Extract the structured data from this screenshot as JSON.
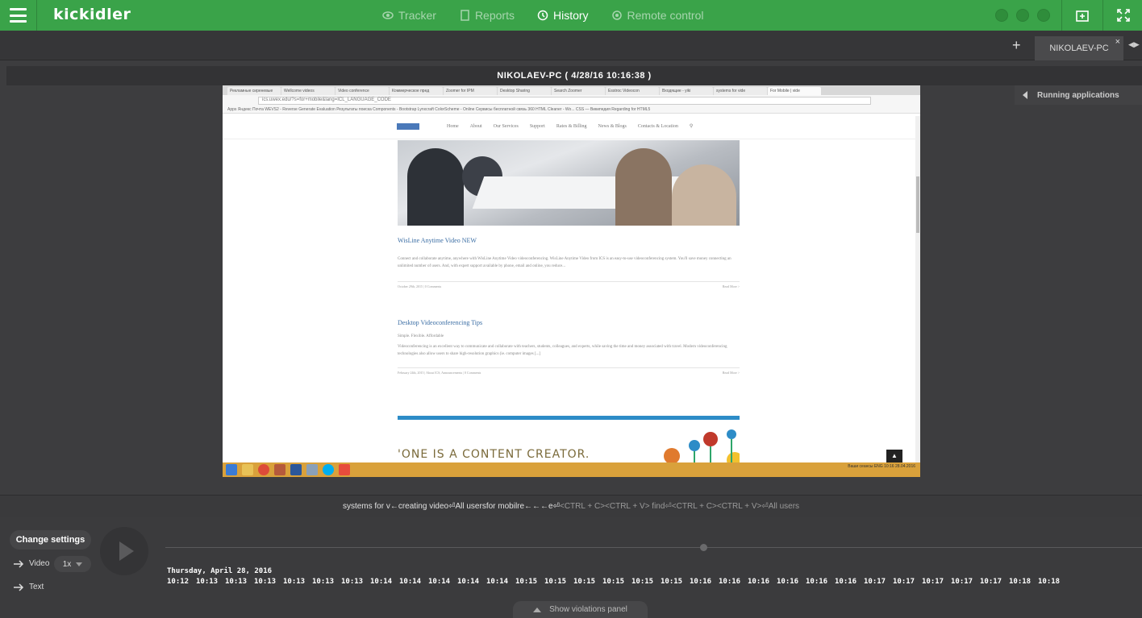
{
  "app": {
    "logo": "kickidler",
    "nav": [
      {
        "label": "Tracker",
        "icon": "eye-icon",
        "active": false
      },
      {
        "label": "Reports",
        "icon": "document-icon",
        "active": false
      },
      {
        "label": "History",
        "icon": "history-clock-icon",
        "active": true
      },
      {
        "label": "Remote control",
        "icon": "remote-icon",
        "active": false
      }
    ]
  },
  "tabs": {
    "add": "+",
    "active_tab": "NIKOLAEV-PC",
    "close": "×",
    "arrows": "◀▶"
  },
  "session": {
    "title": "NIKOLAEV-PC   ( 4/28/16 10:16:38 )"
  },
  "right_panel": {
    "header": "Running applications"
  },
  "screen": {
    "browser_tabs": [
      "Рекламные сиреневые",
      "Wellcome videos",
      "Video conference",
      "Коммерческое пред",
      "Zoomer for IPM",
      "Desktop Sharing",
      "Search  Zoomer",
      "Esstroc Videocon",
      "Входящие  - yiki",
      "systems for vide",
      "For Mobile | vide"
    ],
    "url": "ics.uwex.edu/?s=for+mobile&lang=ICL_LANGUAGE_CODE",
    "bookmarks": "Apps   Яндекс   Почта   WEVS2 - Reverse   Generate Evaluation   Результаты поиска   Components - Bootstrap   Lynxcraft   ColorScheme - Online   Сервисы бесплатной   связь 360   HTML Cleaner - Wo...   CSS — Википедия   Regarding for HTML5",
    "site_nav": [
      "Home",
      "About",
      "Our Services",
      "Support",
      "Rates & Billing",
      "News & Blogs",
      "Contacts & Location"
    ],
    "article1": {
      "title": "WisLine Anytime Video NEW",
      "text": "Connect and collaborate anytime, anywhere with WisLine Anytime Video videoconferencing. WisLine Anytime Video from ICS is an easy-to-use videoconferencing system. You'll save money connecting an unlimited number of users. And, with expert support available by phone, email and online, you reduce...",
      "meta": "October 29th, 2015  |  0 Comments",
      "more": "Read More >"
    },
    "article2": {
      "title": "Desktop Videoconferencing Tips",
      "subtitle": "Simple. Flexible. Affordable",
      "text": "Videoconferencing is an excellent way to communicate and collaborate with teachers, students, colleagues, and experts, while saving the time and money associated with travel. Modern videoconferencing technologies also allow users to share high-resolution graphics (ie. computer images [...]",
      "meta": "February 24th, 2015  |  About ICS, Announcements  |  0 Comments",
      "more": "Read More >"
    },
    "banner": "'ONE IS A CONTENT CREATOR.",
    "tray": "Ваши сеансы  ENG  10:16  28.04.2016"
  },
  "keystrokes": {
    "typed": "systems for v←creating video⏎All usersfor mobilre←←←e⏎",
    "dim": "<CTRL + C><CTRL + V> find⏎<CTRL + C><CTRL + V>⏎All users"
  },
  "controls": {
    "change_settings": "Change settings",
    "video": "Video",
    "text": "Text",
    "speed": "1x",
    "date": "Thursday, April 28, 2016",
    "times": [
      "10:12",
      "10:13",
      "10:13",
      "10:13",
      "10:13",
      "10:13",
      "10:13",
      "10:14",
      "10:14",
      "10:14",
      "10:14",
      "10:14",
      "10:15",
      "10:15",
      "10:15",
      "10:15",
      "10:15",
      "10:15",
      "10:16",
      "10:16",
      "10:16",
      "10:16",
      "10:16",
      "10:16",
      "10:17",
      "10:17",
      "10:17",
      "10:17",
      "10:17",
      "10:18",
      "10:18"
    ],
    "show_violations": "Show violations panel",
    "timeline_progress": 0.66
  },
  "colors": {
    "topbar": "#3aa349",
    "background": "#3d3d3f",
    "taskbar": "#d9a13b"
  }
}
